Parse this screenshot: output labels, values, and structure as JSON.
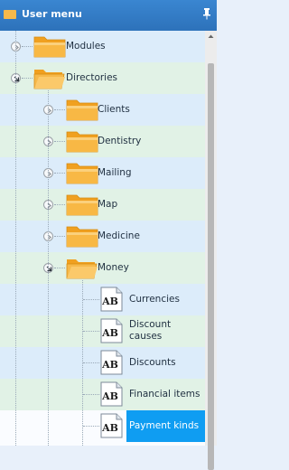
{
  "header": {
    "title": "User menu",
    "menu_icon": "menu-icon",
    "pin_icon": "pin-icon"
  },
  "tree": [
    {
      "label": "Modules",
      "icon": "folder-closed-icon",
      "level": 0,
      "expander": "expand"
    },
    {
      "label": "Directories",
      "icon": "folder-open-icon",
      "level": 0,
      "expander": "collapse"
    },
    {
      "label": "Clients",
      "icon": "folder-closed-icon",
      "level": 1,
      "expander": "expand"
    },
    {
      "label": "Dentistry",
      "icon": "folder-closed-icon",
      "level": 1,
      "expander": "expand"
    },
    {
      "label": "Mailing",
      "icon": "folder-closed-icon",
      "level": 1,
      "expander": "expand"
    },
    {
      "label": "Map",
      "icon": "folder-closed-icon",
      "level": 1,
      "expander": "expand"
    },
    {
      "label": "Medicine",
      "icon": "folder-closed-icon",
      "level": 1,
      "expander": "expand"
    },
    {
      "label": "Money",
      "icon": "folder-open-icon",
      "level": 1,
      "expander": "collapse"
    },
    {
      "label": "Currencies",
      "icon": "ab-document-icon",
      "level": 2,
      "expander": ""
    },
    {
      "label": "Discount causes",
      "line1": "Discount",
      "line2": "causes",
      "icon": "ab-document-icon",
      "level": 2,
      "expander": ""
    },
    {
      "label": "Discounts",
      "icon": "ab-document-icon",
      "level": 2,
      "expander": ""
    },
    {
      "label": "Financial items",
      "icon": "ab-document-icon",
      "level": 2,
      "expander": ""
    },
    {
      "label": "Payment kinds",
      "icon": "ab-document-icon",
      "level": 2,
      "expander": "",
      "selected": true
    }
  ],
  "colors": {
    "header": "#2d72ba",
    "selected": "#0f9df2",
    "folder": "#f5a623",
    "row_green": "#e1f2e6",
    "row_blue": "#dcecfa"
  }
}
